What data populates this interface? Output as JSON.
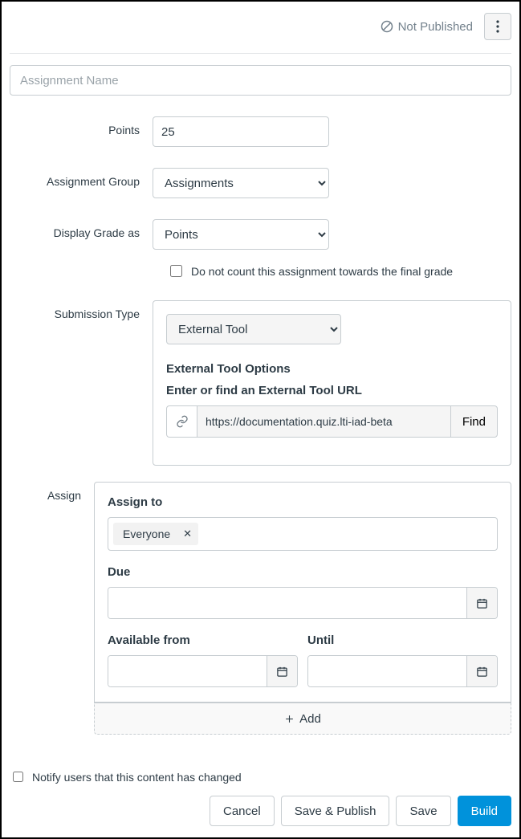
{
  "top": {
    "status": "Not Published"
  },
  "name": {
    "placeholder": "Assignment Name",
    "value": ""
  },
  "labels": {
    "points": "Points",
    "group": "Assignment Group",
    "display": "Display Grade as",
    "submission": "Submission Type",
    "assign": "Assign"
  },
  "points_value": "25",
  "group_selected": "Assignments",
  "display_selected": "Points",
  "no_count": {
    "checked": false,
    "label": "Do not count this assignment towards the final grade"
  },
  "submission": {
    "selected": "External Tool",
    "options_heading": "External Tool Options",
    "url_label": "Enter or find an External Tool URL",
    "url_value": "https://documentation.quiz.lti-iad-beta",
    "find_label": "Find"
  },
  "assign_panel": {
    "assign_to_label": "Assign to",
    "tag": "Everyone",
    "due_label": "Due",
    "due_value": "",
    "from_label": "Available from",
    "from_value": "",
    "until_label": "Until",
    "until_value": "",
    "add_label": "Add"
  },
  "footer": {
    "notify_label": "Notify users that this content has changed",
    "notify_checked": false,
    "cancel": "Cancel",
    "save_publish": "Save & Publish",
    "save": "Save",
    "build": "Build"
  }
}
